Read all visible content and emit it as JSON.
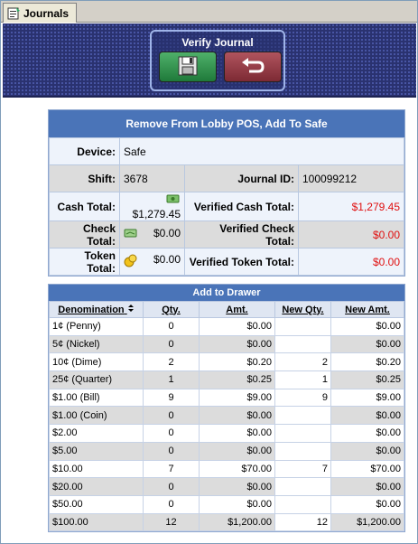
{
  "tab": {
    "label": "Journals"
  },
  "verify": {
    "title": "Verify Journal"
  },
  "panel": {
    "title": "Remove From Lobby POS, Add To Safe",
    "device_label": "Device:",
    "device_value": "Safe",
    "shift_label": "Shift:",
    "shift_value": "3678",
    "journal_label": "Journal ID:",
    "journal_value": "100099212",
    "cash_label": "Cash Total:",
    "cash_value": "$1,279.45",
    "vcash_label": "Verified Cash Total:",
    "vcash_value": "$1,279.45",
    "check_label": "Check Total:",
    "check_value": "$0.00",
    "vcheck_label": "Verified Check Total:",
    "vcheck_value": "$0.00",
    "token_label": "Token Total:",
    "token_value": "$0.00",
    "vtoken_label": "Verified Token Total:",
    "vtoken_value": "$0.00"
  },
  "drawer": {
    "title": "Add to Drawer",
    "columns": [
      "Denomination",
      "Qty.",
      "Amt.",
      "New Qty.",
      "New Amt."
    ],
    "rows": [
      {
        "den": "1¢ (Penny)",
        "qty": "0",
        "amt": "$0.00",
        "new_qty": "",
        "new_amt": "$0.00"
      },
      {
        "den": "5¢ (Nickel)",
        "qty": "0",
        "amt": "$0.00",
        "new_qty": "",
        "new_amt": "$0.00"
      },
      {
        "den": "10¢ (Dime)",
        "qty": "2",
        "amt": "$0.20",
        "new_qty": "2",
        "new_amt": "$0.20"
      },
      {
        "den": "25¢ (Quarter)",
        "qty": "1",
        "amt": "$0.25",
        "new_qty": "1",
        "new_amt": "$0.25"
      },
      {
        "den": "$1.00 (Bill)",
        "qty": "9",
        "amt": "$9.00",
        "new_qty": "9",
        "new_amt": "$9.00"
      },
      {
        "den": "$1.00 (Coin)",
        "qty": "0",
        "amt": "$0.00",
        "new_qty": "",
        "new_amt": "$0.00"
      },
      {
        "den": "$2.00",
        "qty": "0",
        "amt": "$0.00",
        "new_qty": "",
        "new_amt": "$0.00"
      },
      {
        "den": "$5.00",
        "qty": "0",
        "amt": "$0.00",
        "new_qty": "",
        "new_amt": "$0.00"
      },
      {
        "den": "$10.00",
        "qty": "7",
        "amt": "$70.00",
        "new_qty": "7",
        "new_amt": "$70.00"
      },
      {
        "den": "$20.00",
        "qty": "0",
        "amt": "$0.00",
        "new_qty": "",
        "new_amt": "$0.00"
      },
      {
        "den": "$50.00",
        "qty": "0",
        "amt": "$0.00",
        "new_qty": "",
        "new_amt": "$0.00"
      },
      {
        "den": "$100.00",
        "qty": "12",
        "amt": "$1,200.00",
        "new_qty": "12",
        "new_amt": "$1,200.00"
      }
    ]
  }
}
